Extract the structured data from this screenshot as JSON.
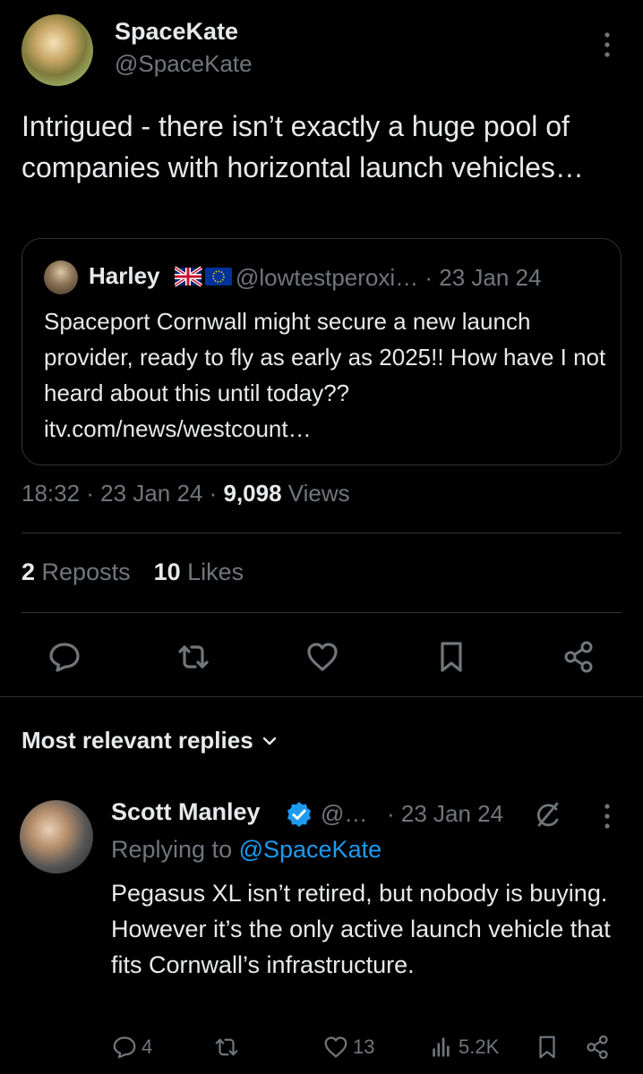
{
  "tweet": {
    "author_name": "SpaceKate",
    "author_handle": "@SpaceKate",
    "text": "Intrigued - there isn’t exactly a huge pool of companies with horizontal launch vehicles…",
    "quote": {
      "name": "Harley",
      "handle_date": "@lowtestperoxi… · 23 Jan 24",
      "text": "Spaceport Cornwall might secure a new launch provider, ready to fly as early as 2025!! How have I not heard about this until today??itv.com/news/westcount…"
    },
    "time_date": "18:32 · 23 Jan 24 · ",
    "views_count": "9,098",
    "views_label": " Views",
    "reposts_count": "2",
    "reposts_label": " Reposts",
    "likes_count": "10",
    "likes_label": " Likes"
  },
  "replies_header": {
    "label": "Most relevant replies"
  },
  "reply": {
    "name": "Scott Manley",
    "handle": "@…",
    "date": "· 23 Jan 24",
    "replying_prefix": "Replying to ",
    "replying_mention": "@SpaceKate",
    "text": "Pegasus XL isn’t retired, but nobody is buying. However it’s the only active launch vehicle that fits Cornwall’s infrastructure.",
    "reply_count": "4",
    "like_count": "13",
    "view_count": "5.2K"
  },
  "icons": [
    "more-vertical-icon",
    "comment-icon",
    "repost-icon",
    "heart-icon",
    "bookmark-icon",
    "share-icon",
    "chevron-down-icon",
    "verified-badge-icon",
    "grok-icon",
    "views-icon",
    "uk-flag-icon",
    "eu-flag-icon"
  ],
  "colors": {
    "background": "#000000",
    "text": "#e7e9ea",
    "muted": "#71767b",
    "border": "#2f3336",
    "accent": "#1d9bf0"
  }
}
